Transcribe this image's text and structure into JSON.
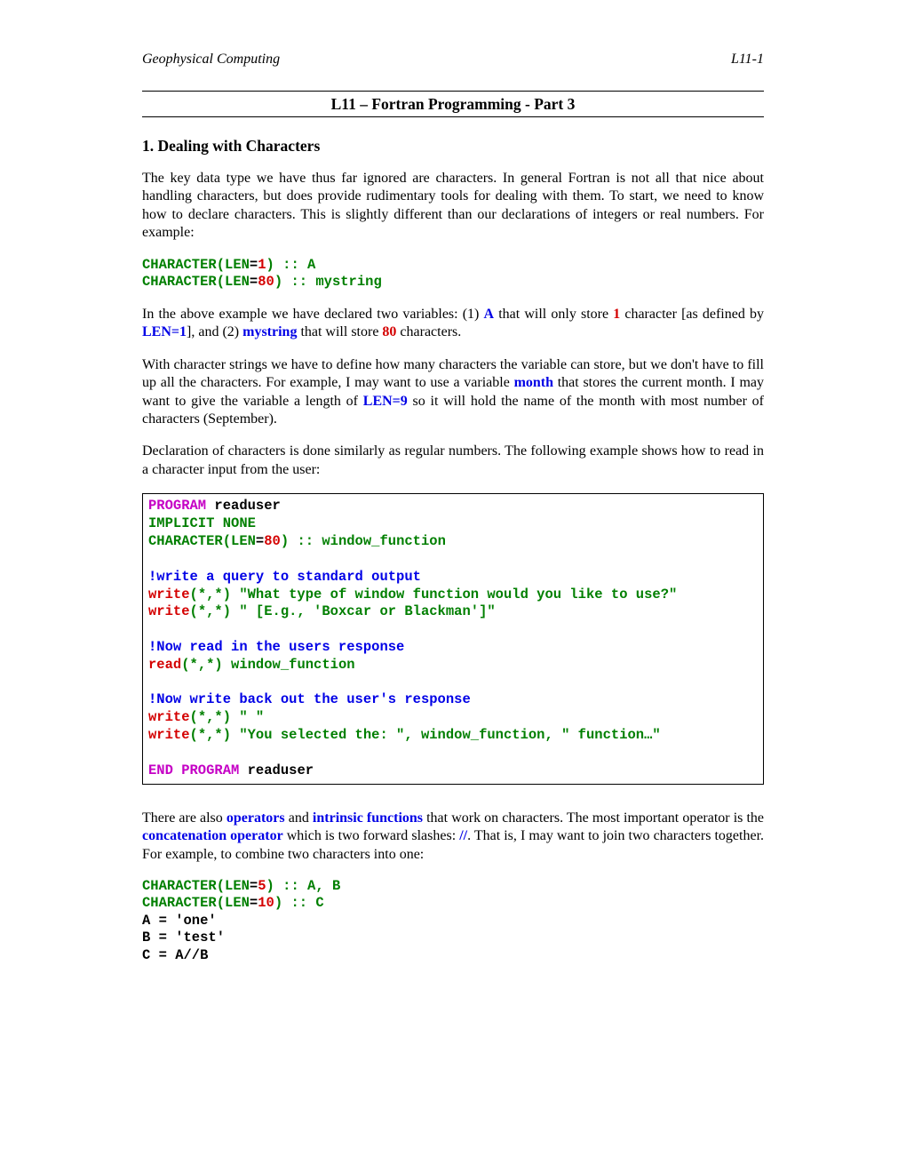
{
  "header": {
    "left": "Geophysical Computing",
    "right": "L11-1"
  },
  "title": "L11 – Fortran Programming - Part 3",
  "section1_heading": "1. Dealing with Characters",
  "para1": "The key data type we have thus far ignored are characters.  In general Fortran is not all that nice about handling characters, but does provide rudimentary tools for dealing with them.  To start, we need to know how to declare characters.  This is slightly different than our declarations of integers or real numbers.  For example:",
  "code1": {
    "kw1": "CHARACTER(LEN",
    "eq1": "=",
    "num1": "1",
    "rest1": ") :: A",
    "kw2": "CHARACTER(LEN",
    "eq2": "=",
    "num2": "80",
    "rest2": ") :: mystring"
  },
  "para2": {
    "t1": "In the above example we have declared two variables: (1) ",
    "a": "A",
    "t2": " that will only store ",
    "one": "1",
    "t3": " character [as defined by ",
    "len1": "LEN=1",
    "t4": "], and (2) ",
    "mystr": "mystring",
    "t5": " that will store ",
    "eighty": "80",
    "t6": " characters."
  },
  "para3": {
    "t1": "With character strings we have to define how many characters the variable can store, but we don't have to fill up all the characters.  For example, I may want to use a variable ",
    "month": "month",
    "t2": " that stores the current month. I may want to give the variable a length of ",
    "len9": "LEN=9",
    "t3": " so it will hold the name of the month with most number of characters (September)."
  },
  "para4": "Declaration of characters is done similarly as regular numbers.  The following example shows how to read in a character input from the user:",
  "codebox": {
    "l1a": "PROGRAM",
    "l1b": " readuser",
    "l2": "IMPLICIT NONE",
    "l3a": "CHARACTER(LEN",
    "l3b": "=",
    "l3c": "80",
    "l3d": ") :: window_function",
    "l5": "!write a query to standard output",
    "l6a": "write",
    "l6b": "(*,*) \"What type of window function would you like to use?\"",
    "l7a": "write",
    "l7b": "(*,*) \" [E.g., 'Boxcar or Blackman']\"",
    "l9": "!Now read in the users response",
    "l10a": "read",
    "l10b": "(*,*) window_function",
    "l12": "!Now write back out the user's response",
    "l13a": "write",
    "l13b": "(*,*) \" \"",
    "l14a": "write",
    "l14b": "(*,*) \"You selected the: \", window_function, \" function…\"",
    "l16a": "END PROGRAM",
    "l16b": " readuser"
  },
  "para5": {
    "t1": "There are also ",
    "ops": "operators",
    "t2": " and ",
    "intr": "intrinsic functions",
    "t3": " that work on characters.  The most important operator is the ",
    "concat": "concatenation operator",
    "t4": " which is two forward slashes: ",
    "slashes": "//",
    "t5": ".  That is, I may want to join two characters together.    For example, to combine two characters into one:"
  },
  "code2": {
    "l1a": "CHARACTER(LEN",
    "l1b": "=",
    "l1c": "5",
    "l1d": ") :: A, B",
    "l2a": "CHARACTER(LEN",
    "l2b": "=",
    "l2c": "10",
    "l2d": ") :: C",
    "l3": "A = 'one'",
    "l4": "B = 'test'",
    "l5": "C = A//B"
  }
}
